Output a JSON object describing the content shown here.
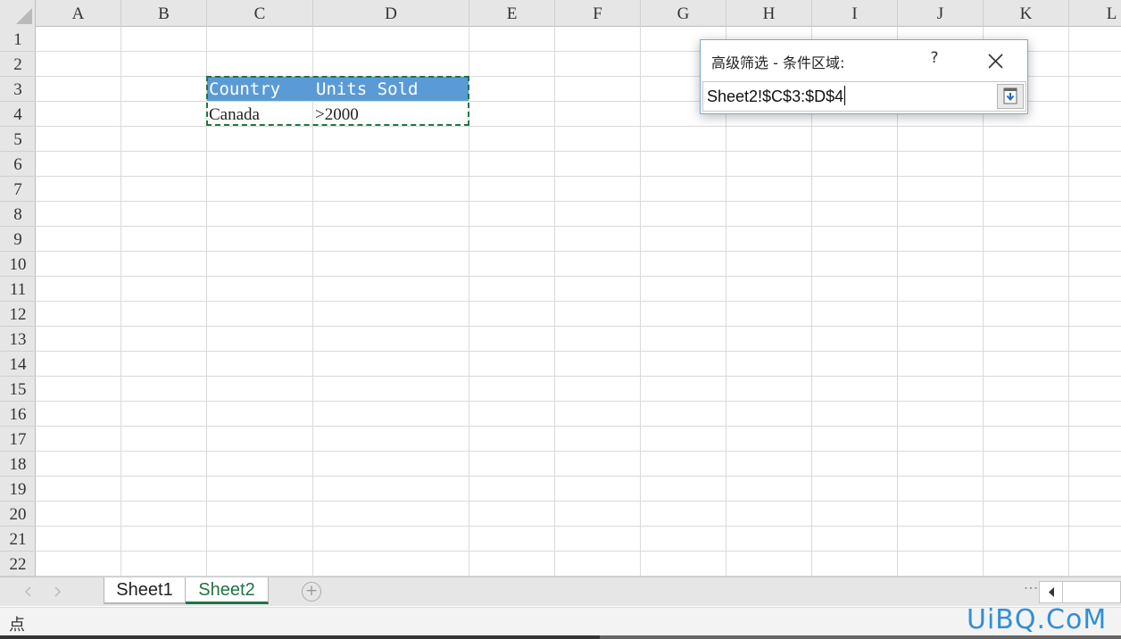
{
  "columns": [
    "A",
    "B",
    "C",
    "D",
    "E",
    "F",
    "G",
    "H",
    "I",
    "J",
    "K",
    "L"
  ],
  "rows": [
    "1",
    "2",
    "3",
    "4",
    "5",
    "6",
    "7",
    "8",
    "9",
    "10",
    "11",
    "12",
    "13",
    "14",
    "15",
    "16",
    "17",
    "18",
    "19",
    "20",
    "21",
    "22"
  ],
  "criteria": {
    "header_country": "Country",
    "header_units": "Units Sold",
    "value_country": "Canada",
    "value_units": ">2000"
  },
  "dialog": {
    "title": "高级筛选 - 条件区域:",
    "help": "?",
    "range_value": "Sheet2!$C$3:$D$4"
  },
  "sheets": [
    "Sheet1",
    "Sheet2"
  ],
  "active_sheet": "Sheet2",
  "add_sheet": "+",
  "status": "点",
  "watermark": "UiBQ.CoM",
  "colors": {
    "header_fill": "#5b9bd5",
    "accent_green": "#217346",
    "watermark": "#2f8fd6"
  }
}
